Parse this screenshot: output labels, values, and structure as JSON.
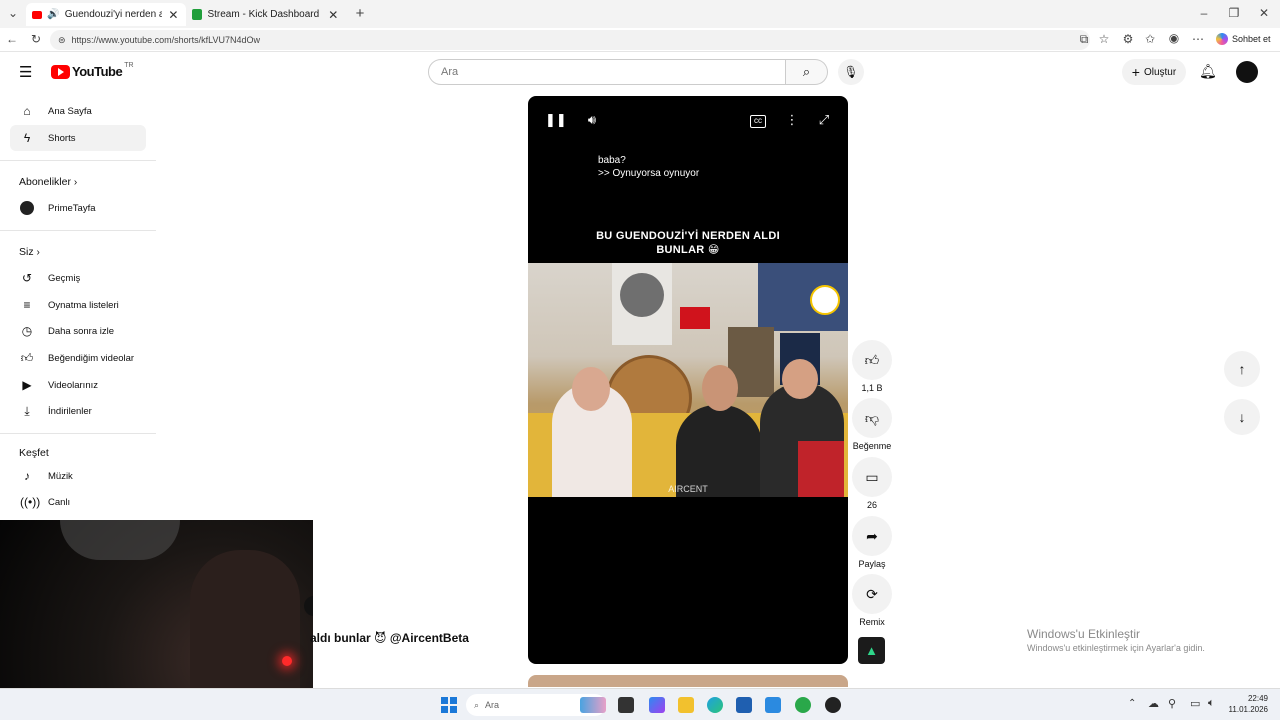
{
  "browser": {
    "tabs": [
      {
        "title": "Guendouzi'yi nerden aldı bun",
        "active": true
      },
      {
        "title": "Stream - Kick Dashboard",
        "active": false
      }
    ],
    "url": "https://www.youtube.com/shorts/kfLVU7N4dOw",
    "profile_label": "Sohbet et"
  },
  "header": {
    "logo": "YouTube",
    "region": "TR",
    "search_placeholder": "Ara",
    "create_label": "Oluştur"
  },
  "sidebar": {
    "main": [
      {
        "label": "Ana Sayfa",
        "icon": "home-icon"
      },
      {
        "label": "Shorts",
        "icon": "shorts-icon",
        "active": true
      }
    ],
    "subs_heading": "Abonelikler",
    "subs": [
      {
        "label": "PrimeTayfa"
      }
    ],
    "you_heading": "Siz",
    "you": [
      {
        "label": "Geçmiş",
        "icon": "history-icon"
      },
      {
        "label": "Oynatma listeleri",
        "icon": "playlist-icon"
      },
      {
        "label": "Daha sonra izle",
        "icon": "clock-icon"
      },
      {
        "label": "Beğendiğim videolar",
        "icon": "like-icon"
      },
      {
        "label": "Videolarınız",
        "icon": "video-icon"
      },
      {
        "label": "İndirilenler",
        "icon": "download-icon"
      }
    ],
    "explore_heading": "Keşfet",
    "explore": [
      {
        "label": "Müzik",
        "icon": "music-icon"
      },
      {
        "label": "Canlı",
        "icon": "live-icon"
      }
    ]
  },
  "video": {
    "caption_line1": "baba?",
    "caption_line2": ">> Oynuyorsa oynuyor",
    "overlay_line1": "BU GUENDOUZİ'Yİ NERDEN ALDI",
    "overlay_line2": "BUNLAR 😁",
    "watermark": "AIRCENT",
    "bottom_title": "aldı bunlar 😈 @AircentBeta"
  },
  "actions": {
    "likes": "1,1 B",
    "dislike_label": "Beğenme",
    "comments": "26",
    "share_label": "Paylaş",
    "remix_label": "Remix"
  },
  "windows_activation": {
    "title": "Windows'u Etkinleştir",
    "subtitle": "Windows'u etkinleştirmek için Ayarlar'a gidin."
  },
  "taskbar": {
    "search_placeholder": "Ara",
    "time": "22:49",
    "date": "11.01.2026"
  }
}
